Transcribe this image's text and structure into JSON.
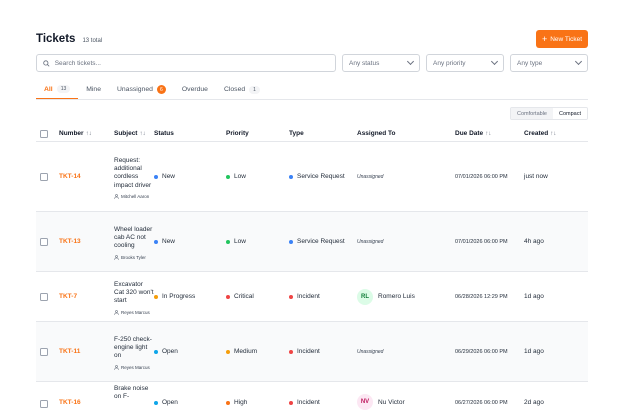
{
  "header": {
    "title": "Tickets",
    "total": "13 total",
    "new_button": "New Ticket"
  },
  "filters": {
    "search_placeholder": "Search tickets...",
    "status": "Any status",
    "priority": "Any priority",
    "type": "Any type"
  },
  "tabs": [
    {
      "label": "All",
      "count": "13"
    },
    {
      "label": "Mine",
      "count": ""
    },
    {
      "label": "Unassigned",
      "count": "6"
    },
    {
      "label": "Overdue",
      "count": ""
    },
    {
      "label": "Closed",
      "count": "1"
    }
  ],
  "density": {
    "comfortable": "Comfortable",
    "compact": "Compact"
  },
  "columns": {
    "number": "Number",
    "subject": "Subject",
    "status": "Status",
    "priority": "Priority",
    "type": "Type",
    "assigned": "Assigned To",
    "due": "Due Date",
    "created": "Created"
  },
  "colors": {
    "accent": "#f97316",
    "status_new": "#3b82f6",
    "status_in_progress": "#f59e0b",
    "status_open": "#0ea5e9",
    "priority_low": "#22c55e",
    "priority_critical": "#ef4444",
    "priority_medium": "#f59e0b",
    "type_service": "#3b82f6",
    "type_incident": "#ef4444"
  },
  "rows": [
    {
      "number": "TKT-14",
      "subject": "Request: additional cordless impact driver",
      "requester": "Mitchell Aaron",
      "status": "New",
      "priority": "Low",
      "type": "Service Request",
      "assigned": "Unassigned",
      "due": "07/01/2026 06:00 PM",
      "created": "just now"
    },
    {
      "number": "TKT-13",
      "subject": "Wheel loader cab AC not cooling",
      "requester": "Brooks Tyler",
      "status": "New",
      "priority": "Low",
      "type": "Service Request",
      "assigned": "Unassigned",
      "due": "07/01/2026 06:00 PM",
      "created": "4h ago"
    },
    {
      "number": "TKT-7",
      "subject": "Excavator Cat 320 won't start",
      "requester": "Reyes Marcus",
      "status": "In Progress",
      "priority": "Critical",
      "type": "Incident",
      "assigned_initials": "RL",
      "assigned": "Romero Luis",
      "due": "06/28/2026 12:29 PM",
      "created": "1d ago"
    },
    {
      "number": "TKT-11",
      "subject": "F-250 check-engine light on",
      "requester": "Reyes Marcus",
      "status": "Open",
      "priority": "Medium",
      "type": "Incident",
      "assigned": "Unassigned",
      "due": "06/29/2026 06:00 PM",
      "created": "1d ago"
    },
    {
      "number": "TKT-16",
      "subject": "Brake noise on F-",
      "status": "Open",
      "priority": "High",
      "type": "Incident",
      "assigned_initials": "NV",
      "assigned": "Nu Victor",
      "due": "06/27/2026 06:00 PM",
      "created": "2d ago"
    }
  ]
}
